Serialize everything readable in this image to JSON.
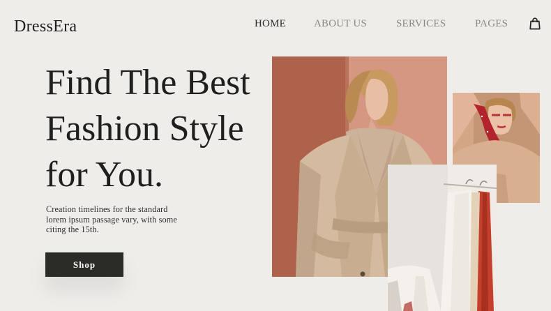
{
  "brand": {
    "name": "DressEra"
  },
  "nav": {
    "items": [
      {
        "label": "HOME",
        "active": true
      },
      {
        "label": "ABOUT US",
        "active": false
      },
      {
        "label": "SERVICES",
        "active": false
      },
      {
        "label": "PAGES",
        "active": false
      }
    ],
    "cart_icon": "shopping-bag-icon"
  },
  "hero": {
    "headline_lines": [
      "Find The Best",
      "Fashion Style",
      "for You."
    ],
    "description_lines": [
      "Creation timelines for the standard",
      "lorem ipsum passage vary, with some",
      "citing the 15th."
    ],
    "cta_label": "Shop"
  },
  "colors": {
    "background": "#efedea",
    "text_dark": "#1f1f1f",
    "nav_inactive": "#8a8784",
    "button_bg": "#2b2b28",
    "button_text": "#ffffff"
  }
}
